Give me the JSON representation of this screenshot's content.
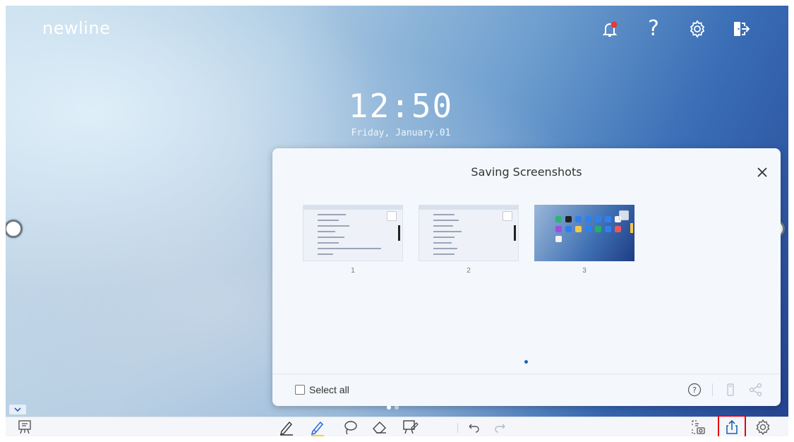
{
  "app": {
    "brand": "newline"
  },
  "top_bar": {
    "icons": [
      "notification-bell-icon",
      "help-icon",
      "settings-icon",
      "exit-icon"
    ],
    "help_label": "?"
  },
  "clock": {
    "time": "12:50",
    "date": "Friday, January.01"
  },
  "dialog": {
    "title": "Saving Screenshots",
    "thumbnails": [
      {
        "label": "1",
        "style": "light"
      },
      {
        "label": "2",
        "style": "light"
      },
      {
        "label": "3",
        "style": "dark"
      }
    ],
    "select_all_label": "Select all",
    "footer_icons": [
      "help-circle-icon",
      "usb-drive-icon",
      "share-nodes-icon"
    ]
  },
  "toolbar": {
    "left_icon": "whiteboard-icon",
    "center_tools": [
      "pen-icon",
      "highlighter-pen-icon",
      "lasso-icon",
      "eraser-icon",
      "whiteboard-board-icon",
      "undo-icon",
      "redo-icon"
    ],
    "right_tools": [
      "screenshot-icon",
      "share-upload-icon",
      "settings-icon"
    ]
  },
  "colors": {
    "accent": "#1a64b8",
    "highlight_border": "#e60012",
    "pen_active": "#ffcc33"
  }
}
